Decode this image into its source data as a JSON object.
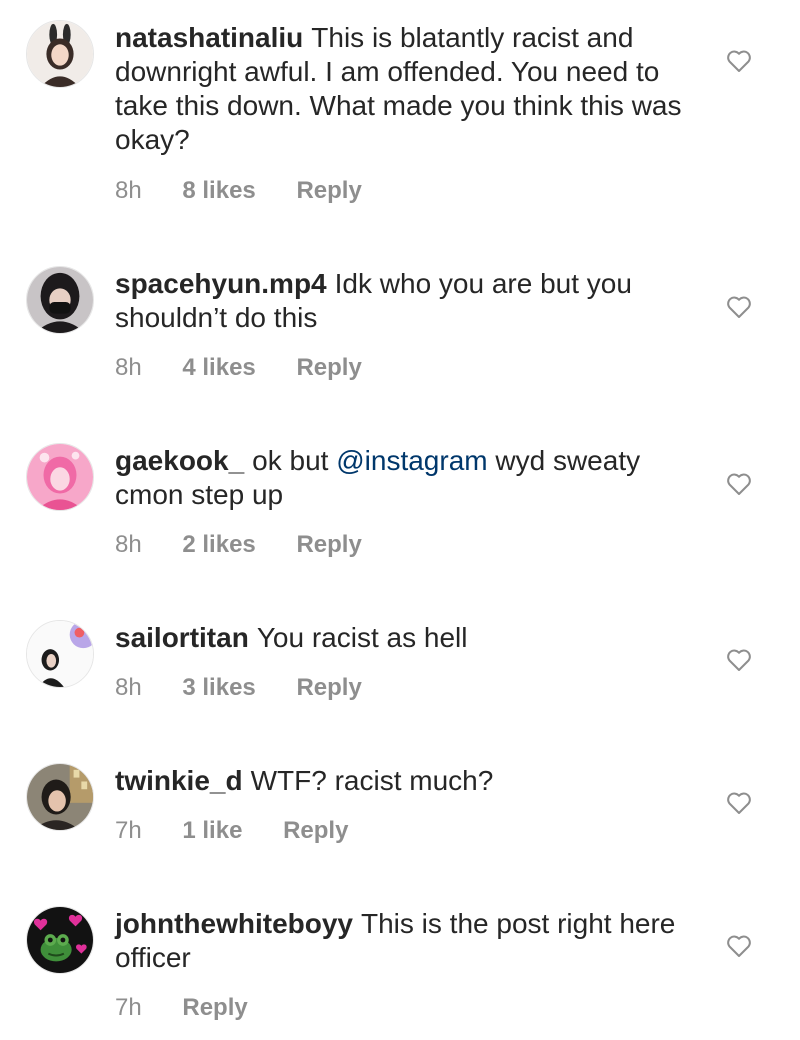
{
  "comments": [
    {
      "username": "natashatinaliu",
      "text": "This is blatantly racist and downright awful. I am offended. You need to take this down. What made you think this was okay?",
      "time": "8h",
      "likes": "8 likes",
      "reply": "Reply",
      "avatar_icon": "profile-photo-bunny-ears"
    },
    {
      "username": "spacehyun.mp4",
      "text": "Idk who you are but you shouldn’t do this",
      "time": "8h",
      "likes": "4 likes",
      "reply": "Reply",
      "avatar_icon": "profile-photo-dark-hair-mask"
    },
    {
      "username": "gaekook_",
      "text_before": "ok but",
      "mention": "@instagram",
      "text_after": "wyd sweaty cmon step up",
      "time": "8h",
      "likes": "2 likes",
      "reply": "Reply",
      "avatar_icon": "profile-photo-pink"
    },
    {
      "username": "sailortitan",
      "text": "You racist as hell",
      "time": "8h",
      "likes": "3 likes",
      "reply": "Reply",
      "avatar_icon": "profile-photo-sticker"
    },
    {
      "username": "twinkie_d",
      "text": "WTF? racist much?",
      "time": "7h",
      "likes": "1 like",
      "reply": "Reply",
      "avatar_icon": "profile-photo-city"
    },
    {
      "username": "johnthewhiteboyy",
      "text": "This is the post right here officer",
      "time": "7h",
      "reply": "Reply",
      "avatar_icon": "profile-photo-frog-hearts"
    }
  ],
  "icons": {
    "like": "heart-outline-icon"
  },
  "colors": {
    "text": "#262626",
    "meta": "#8e8e8e",
    "mention": "#00376b",
    "icon": "#8e8e8e"
  }
}
